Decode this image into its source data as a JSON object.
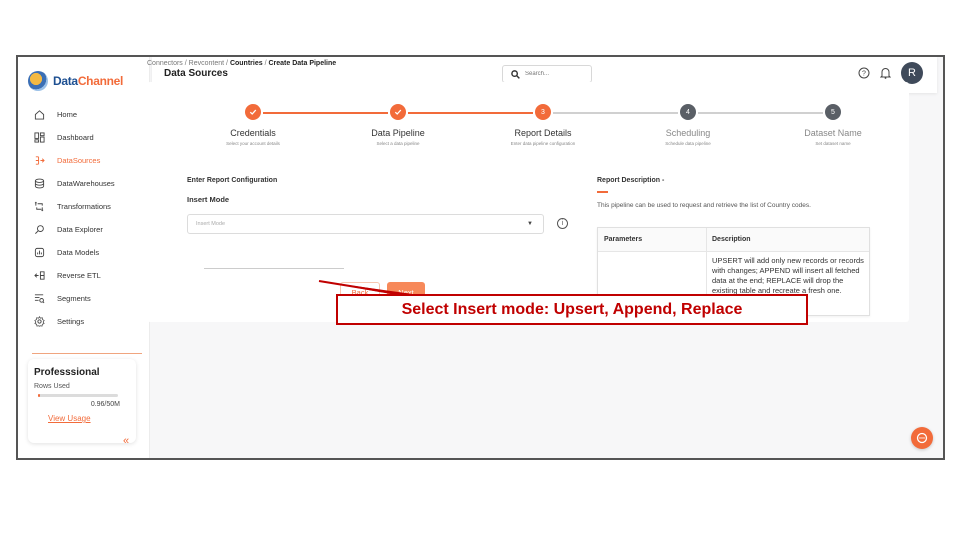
{
  "brand": {
    "name_part1": "Data",
    "name_part2": "Channel"
  },
  "sidebar": {
    "items": [
      {
        "label": "Home",
        "icon": "home-icon",
        "active": false
      },
      {
        "label": "Dashboard",
        "icon": "dashboard-icon",
        "active": false
      },
      {
        "label": "DataSources",
        "icon": "datasources-icon",
        "active": true
      },
      {
        "label": "DataWarehouses",
        "icon": "database-icon",
        "active": false
      },
      {
        "label": "Transformations",
        "icon": "transform-icon",
        "active": false
      },
      {
        "label": "Data Explorer",
        "icon": "explorer-icon",
        "active": false
      },
      {
        "label": "Data Models",
        "icon": "models-icon",
        "active": false
      },
      {
        "label": "Reverse ETL",
        "icon": "reverse-etl-icon",
        "active": false
      },
      {
        "label": "Segments",
        "icon": "segments-icon",
        "active": false
      },
      {
        "label": "Settings",
        "icon": "settings-icon",
        "active": false
      }
    ],
    "plan": {
      "title": "Professsional",
      "rows_label": "Rows Used",
      "rows_value": "0.96/50M",
      "usage_fraction": 0.02,
      "link": "View Usage"
    },
    "collapse_glyph": "«"
  },
  "header": {
    "title": "Data Sources",
    "search_placeholder": "Search..."
  },
  "breadcrumb": {
    "c1": "Connectors",
    "c2": "Revcontent",
    "c3": "Countries",
    "c4": "Create Data Pipeline",
    "sep": "/"
  },
  "stepper": {
    "steps": [
      {
        "label": "Credentials",
        "sub": "Select your account details",
        "state": "done",
        "num": ""
      },
      {
        "label": "Data Pipeline",
        "sub": "Select a data pipeline",
        "state": "done",
        "num": ""
      },
      {
        "label": "Report Details",
        "sub": "Enter data pipeline configuration",
        "state": "current",
        "num": "3"
      },
      {
        "label": "Scheduling",
        "sub": "Schedule data pipeline",
        "state": "pending",
        "num": "4"
      },
      {
        "label": "Dataset Name",
        "sub": "Set dataset name",
        "state": "pending",
        "num": "5"
      }
    ]
  },
  "form": {
    "section_title": "Enter Report Configuration",
    "insert_mode_label": "Insert Mode",
    "insert_mode_placeholder": "Insert Mode",
    "back_label": "Back",
    "next_label": "Next"
  },
  "description": {
    "title": "Report Description -",
    "text": "This pipeline can be used to request and retrieve the list of Country codes.",
    "col_param": "Parameters",
    "col_desc": "Description",
    "param_desc": "UPSERT will add only new records or records with changes; APPEND will insert all fetched data at the end; REPLACE will drop the existing table and recreate a fresh one."
  },
  "callout": {
    "text": "Select Insert mode: Upsert, Append, Replace"
  },
  "colors": {
    "accent": "#f26b3a",
    "callout": "#c00000",
    "pending": "#5a5f66"
  },
  "avatar_initial": "R"
}
